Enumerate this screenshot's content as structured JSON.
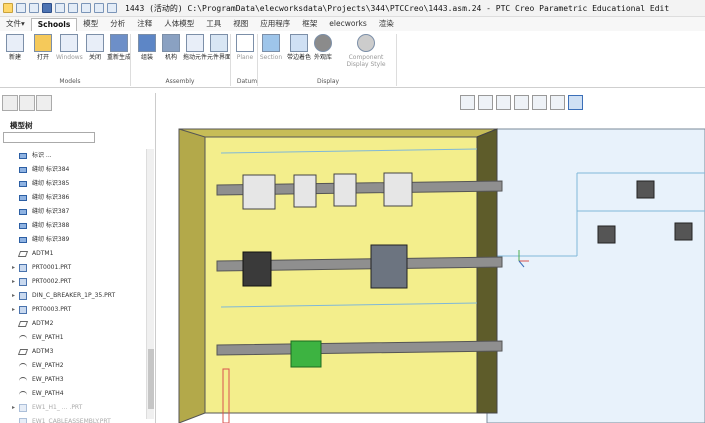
{
  "titlebar": {
    "title": "1443 (活动的) C:\\ProgramData\\elecworksdata\\Projects\\344\\PTCCreo\\1443.asm.24 - PTC Creo Parametric Educational Edit"
  },
  "tabs": [
    "文件▾",
    "Schools",
    "模型",
    "分析",
    "注释",
    "人体模型",
    "工具",
    "视图",
    "应用程序",
    "框架",
    "elecworks",
    "渲染"
  ],
  "active_tab": "Schools",
  "ribbon": {
    "buttons": [
      {
        "label": "新建",
        "icon": "new-icon"
      },
      {
        "label": "打开",
        "icon": "open-folder-icon"
      },
      {
        "label": "Windows",
        "icon": "windows-icon",
        "dim": true
      },
      {
        "label": "关闭",
        "icon": "close-icon"
      },
      {
        "label": "重新生成",
        "icon": "regenerate-icon"
      },
      {
        "label": "组装",
        "icon": "assemble-icon"
      },
      {
        "label": "机构",
        "icon": "mechanism-icon"
      },
      {
        "label": "拖动元件",
        "icon": "drag-hand-icon"
      },
      {
        "label": "元件界面",
        "icon": "component-interface-icon"
      },
      {
        "label": "Plane",
        "icon": "plane-icon",
        "dim": true
      },
      {
        "label": "Section",
        "icon": "section-icon",
        "dim": true
      },
      {
        "label": "带边着色",
        "icon": "shading-edges-icon"
      },
      {
        "label": "外观库",
        "icon": "appearance-icon"
      },
      {
        "label": "Component Display Style",
        "icon": "display-style-icon",
        "dim": true
      }
    ],
    "groups": [
      "Models",
      "Assembly",
      "Datum",
      "Display"
    ]
  },
  "sidebar": {
    "title": "模型树",
    "items": [
      {
        "text": "标识 ...",
        "type": "feat"
      },
      {
        "text": "缝纫 标识384",
        "type": "feat"
      },
      {
        "text": "缝纫 标识385",
        "type": "feat"
      },
      {
        "text": "缝纫 标识386",
        "type": "feat"
      },
      {
        "text": "缝纫 标识387",
        "type": "feat"
      },
      {
        "text": "缝纫 标识388",
        "type": "feat"
      },
      {
        "text": "缝纫 标识389",
        "type": "feat"
      },
      {
        "text": "ADTM1",
        "type": "plane"
      },
      {
        "text": "PRT0001.PRT",
        "type": "part",
        "expand": "▸"
      },
      {
        "text": "PRT0002.PRT",
        "type": "part",
        "expand": "▸"
      },
      {
        "text": "DIN_C_BREAKER_1P_35.PRT",
        "type": "part",
        "expand": "▸"
      },
      {
        "text": "PRT0003.PRT",
        "type": "part",
        "expand": "▸"
      },
      {
        "text": "ADTM2",
        "type": "plane"
      },
      {
        "text": "EW_PATH1",
        "type": "path"
      },
      {
        "text": "ADTM3",
        "type": "plane"
      },
      {
        "text": "EW_PATH2",
        "type": "path"
      },
      {
        "text": "EW_PATH3",
        "type": "path"
      },
      {
        "text": "EW_PATH4",
        "type": "path"
      },
      {
        "text": "EW1_H1_ ... .PRT",
        "type": "part",
        "expand": "▸",
        "grey": true
      },
      {
        "text": "EW1_CABLEASSEMBLY.PRT",
        "type": "part",
        "grey": true
      }
    ]
  },
  "view_toolbar": [
    {
      "icon": "zoom-icon"
    },
    {
      "icon": "saved-view-icon"
    },
    {
      "icon": "repaint-icon"
    },
    {
      "icon": "orient-icon"
    },
    {
      "icon": "layers-icon"
    },
    {
      "icon": "spin-center-icon"
    },
    {
      "icon": "annotation-icon",
      "active": true
    }
  ]
}
